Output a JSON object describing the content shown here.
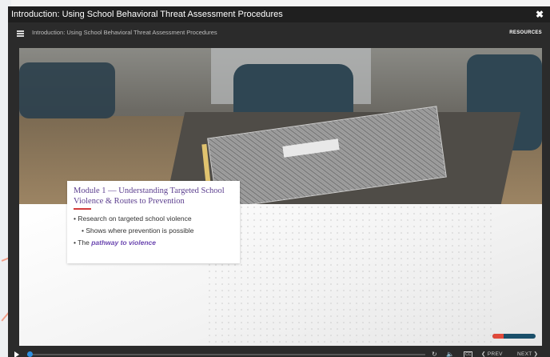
{
  "window": {
    "title": "Introduction: Using School Behavioral Threat Assessment Procedures",
    "close_symbol": "✖"
  },
  "navbar": {
    "title": "Introduction: Using School Behavioral Threat Assessment Procedures",
    "resources_label": "RESOURCES"
  },
  "slide": {
    "module_title": "Module 1 — Understanding Targeted School Violence & Routes to Prevention",
    "bullets": {
      "b1": "• Research on targeted school violence",
      "b2": "• Shows where prevention is possible",
      "b3_prefix": "• The ",
      "b3_emphasis": "pathway to violence"
    },
    "progress_fraction": 0.25
  },
  "controls": {
    "seek_fraction": 0.005,
    "replay_symbol": "↻",
    "volume_symbol": "🔈",
    "cc_label": "CC",
    "prev_label": "❮ PREV",
    "next_label": "NEXT ❯"
  },
  "colors": {
    "accent_purple": "#5c3f8f",
    "underline_red": "#d23b3b",
    "seek_blue": "#2d8fe0",
    "progress_red": "#e0493a",
    "progress_track": "#1a4f6a"
  }
}
